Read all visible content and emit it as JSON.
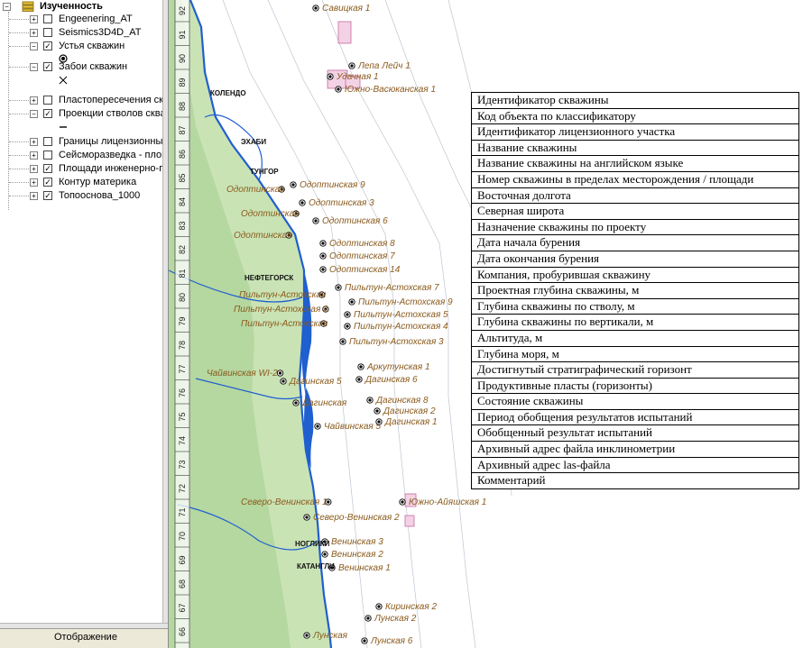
{
  "layer_panel": {
    "root_label": "Изученность",
    "layers": [
      {
        "label": "Engeenering_AT",
        "checked": false,
        "expanded": false
      },
      {
        "label": "Seismics3D4D_AT",
        "checked": false,
        "expanded": false
      },
      {
        "label": "Устья скважин",
        "checked": true,
        "expanded": true
      },
      {
        "label": "Забои скважин",
        "checked": true,
        "expanded": true
      },
      {
        "label": "Пластопересечения скв",
        "checked": false,
        "expanded": false
      },
      {
        "label": "Проекции стволов сква",
        "checked": true,
        "expanded": true
      },
      {
        "label": "Границы лицензионных",
        "checked": false,
        "expanded": false
      },
      {
        "label": "Сейсморазведка - площ",
        "checked": false,
        "expanded": false
      },
      {
        "label": "Площади инженерно-ге",
        "checked": true,
        "expanded": false
      },
      {
        "label": "Контур материка",
        "checked": true,
        "expanded": false
      },
      {
        "label": "Топооснова_1000",
        "checked": true,
        "expanded": false
      }
    ],
    "display_tab": "Отображение"
  },
  "map": {
    "grid_numbers": [
      "92",
      "91",
      "90",
      "89",
      "88",
      "87",
      "86",
      "85",
      "84",
      "83",
      "82",
      "81",
      "80",
      "79",
      "78",
      "77",
      "76",
      "75",
      "74",
      "73",
      "72",
      "71",
      "70",
      "69",
      "68",
      "67",
      "66"
    ],
    "settlements": [
      "КОЛЕНДО",
      "ЭХАБИ",
      "ТУНГОР",
      "НЕФТЕГОРСК",
      "НОГЛИКИ",
      "КАТАНГЛИ"
    ],
    "wells": [
      "Савицкая 1",
      "Лепа Лейч 1",
      "Удачная 1",
      "Южно-Васюканская 1",
      "Одоптинская 9",
      "Одоптинская",
      "Одоптинская 3",
      "Одоптинская",
      "Одоптинская 6",
      "Одоптинская",
      "Одоптинская 8",
      "Одоптинская 7",
      "Одоптинская 14",
      "Пильтун-Астохская 7",
      "Пильтун-Астохская",
      "Пильтун-Астохская 9",
      "Пильтун-Астохская 2",
      "Пильтун-Астохская 5",
      "Пильтун-Астохская",
      "Пильтун-Астохская 4",
      "Пильтун-Астохская 3",
      "Аркутунская 1",
      "Чайвинская WI-2",
      "Дагинская 5",
      "Дагинская 6",
      "Дагинская 8",
      "Дагинская",
      "Дагинская 2",
      "Чайвинская 5",
      "Дагинская 1",
      "Северо-Венинская 1",
      "Южно-Айяшская 1",
      "Северо-Венинская 2",
      "Венинская 3",
      "Венинская 2",
      "Венинская 1",
      "Киринская 2",
      "Лунская 2",
      "Лунская",
      "Лунская 6"
    ],
    "colors": {
      "land": "#c9e3b5",
      "land_dark": "#a9cf92",
      "water": "#1f5fcf",
      "sea": "#ffffff",
      "label": "#8a5a1c"
    }
  },
  "attributes": [
    "Идентификатор скважины",
    "Код объекта по классификатору",
    "Идентификатор лицензионного участка",
    "Название скважины",
    "Название скважины на английском языке",
    "Номер скважины в пределах месторождения / площади",
    "Восточная долгота",
    "Северная широта",
    "Назначение скважины по проекту",
    "Дата начала бурения",
    "Дата окончания бурения",
    "Компания, пробурившая скважину",
    "Проектная глубина скважины, м",
    "Глубина скважины по стволу, м",
    "Глубина скважины по вертикали, м",
    "Альтитуда, м",
    "Глубина моря, м",
    "Достигнутый стратиграфический горизонт",
    "Продуктивные пласты (горизонты)",
    "Состояние скважины",
    "Период обобщения результатов испытаний",
    "Обобщенный результат испытаний",
    "Архивный адрес файла инклинометрии",
    "Архивный адрес las-файла",
    "Комментарий"
  ]
}
